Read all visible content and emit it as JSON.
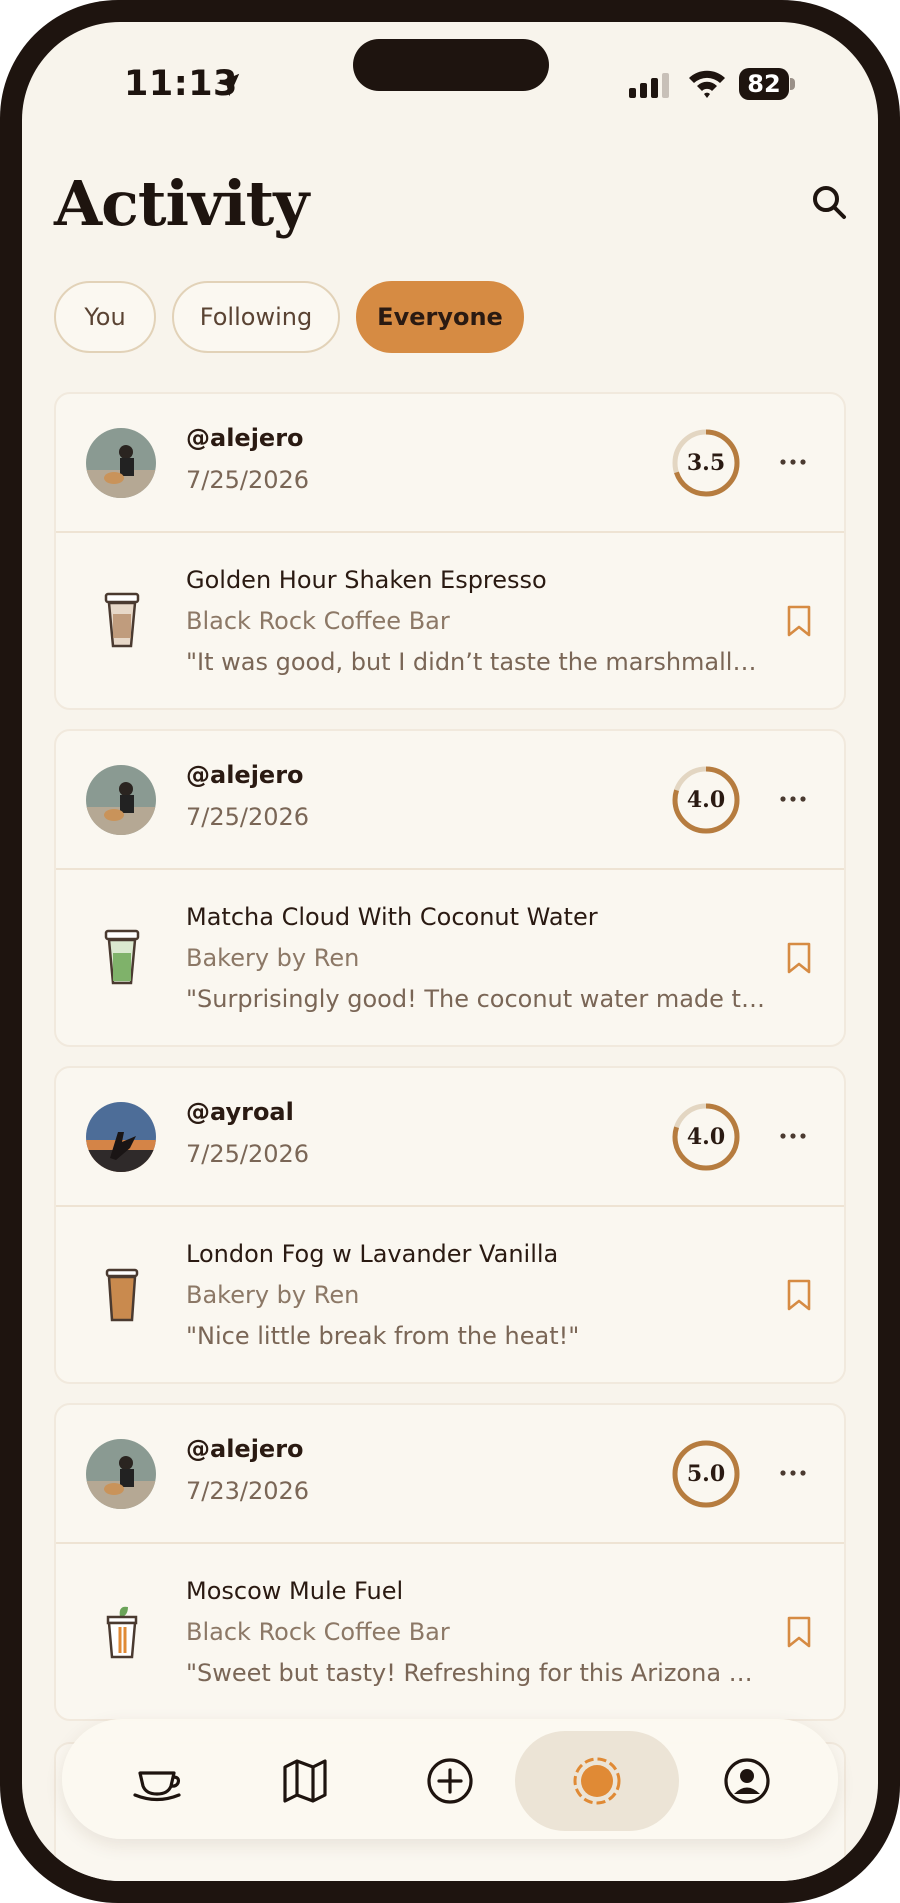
{
  "status_bar": {
    "time": "11:13",
    "battery": "82"
  },
  "header": {
    "title": "Activity"
  },
  "filters": [
    {
      "label": "You",
      "active": false
    },
    {
      "label": "Following",
      "active": false
    },
    {
      "label": "Everyone",
      "active": true
    }
  ],
  "feed": [
    {
      "username": "@alejero",
      "date": "7/25/2026",
      "rating": "3.5",
      "drink": "Golden Hour Shaken Espresso",
      "cafe": "Black Rock Coffee Bar",
      "review": "\"It was good, but I didn’t taste the marshmallow..."
    },
    {
      "username": "@alejero",
      "date": "7/25/2026",
      "rating": "4.0",
      "drink": "Matcha Cloud With Coconut Water",
      "cafe": "Bakery by Ren",
      "review": "\"Surprisingly good! The coconut water made th..."
    },
    {
      "username": "@ayroal",
      "date": "7/25/2026",
      "rating": "4.0",
      "drink": "London Fog w Lavander Vanilla",
      "cafe": "Bakery by Ren",
      "review": "\"Nice little break from the heat!\""
    },
    {
      "username": "@alejero",
      "date": "7/23/2026",
      "rating": "5.0",
      "drink": "Moscow Mule Fuel",
      "cafe": "Black Rock Coffee Bar",
      "review": "\"Sweet but tasty! Refreshing for this Arizona he..."
    }
  ],
  "tab_bar": [
    {
      "icon": "cup-icon",
      "active": false
    },
    {
      "icon": "map-icon",
      "active": false
    },
    {
      "icon": "add-icon",
      "active": false
    },
    {
      "icon": "activity-icon",
      "active": true
    },
    {
      "icon": "profile-icon",
      "active": false
    }
  ],
  "colors": {
    "accent": "#d68b43",
    "background": "#f8f4ec",
    "text": "#2a1a12"
  }
}
